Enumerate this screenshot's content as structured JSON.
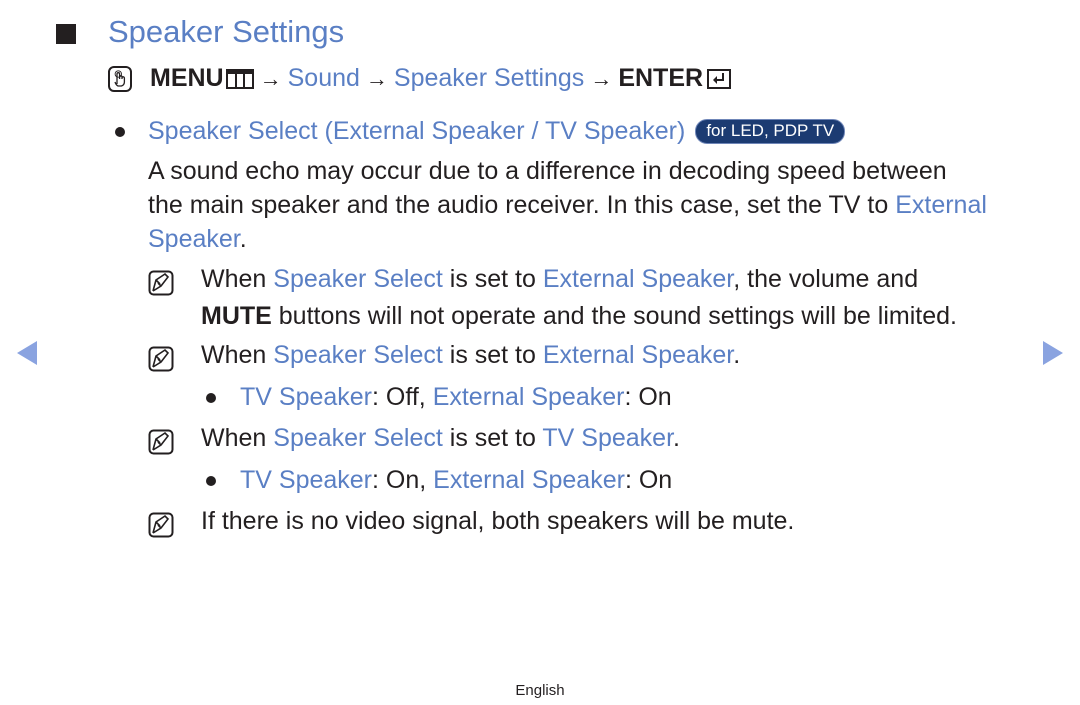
{
  "page": {
    "title": "Speaker Settings",
    "footer_language": "English"
  },
  "colors": {
    "accent": "#5a7fc4",
    "text": "#231f20",
    "badge_bg": "#1c3b72",
    "nav_arrow": "#8aa3e0"
  },
  "path": {
    "icon": "online-manual-hand-icon",
    "menu_label": "MENU",
    "menu_icon": "menu-icon",
    "arrow": "→",
    "step1": "Sound",
    "step2": "Speaker Settings",
    "enter_label": "ENTER",
    "enter_icon": "enter-icon"
  },
  "item": {
    "heading": "Speaker Select (External Speaker / TV Speaker)",
    "badge": "for LED, PDP TV",
    "desc_line1": "A sound echo may occur due to a difference in decoding speed between",
    "desc_line2_a": "the main speaker and the audio receiver. In this case, set the TV to ",
    "desc_line2_b": "External",
    "desc_line3_a": "Speaker",
    "desc_line3_b": "."
  },
  "notes": [
    {
      "icon": "note-icon",
      "line1": [
        {
          "t": "When ",
          "hl": false
        },
        {
          "t": "Speaker Select",
          "hl": true
        },
        {
          "t": " is set to ",
          "hl": false
        },
        {
          "t": "External Speaker",
          "hl": true
        },
        {
          "t": ", the volume and",
          "hl": false
        }
      ],
      "line2_bold": "MUTE",
      "line2_rest": " buttons will not operate and the sound settings will be limited."
    },
    {
      "icon": "note-icon",
      "a": "When ",
      "b": "Speaker Select",
      "c": " is set to ",
      "d": "External Speaker",
      "e": ".",
      "sub": {
        "a": "TV Speaker",
        "b": ": Off, ",
        "c": "External Speaker",
        "d": ": On"
      }
    },
    {
      "icon": "note-icon",
      "a": "When ",
      "b": "Speaker Select",
      "c": " is set to ",
      "d": "TV Speaker",
      "e": ".",
      "sub": {
        "a": "TV Speaker",
        "b": ": On, ",
        "c": "External Speaker",
        "d": ": On"
      }
    },
    {
      "icon": "note-icon",
      "text": "If there is no video signal, both speakers will be mute."
    }
  ],
  "nav": {
    "prev": "previous-page",
    "next": "next-page"
  }
}
